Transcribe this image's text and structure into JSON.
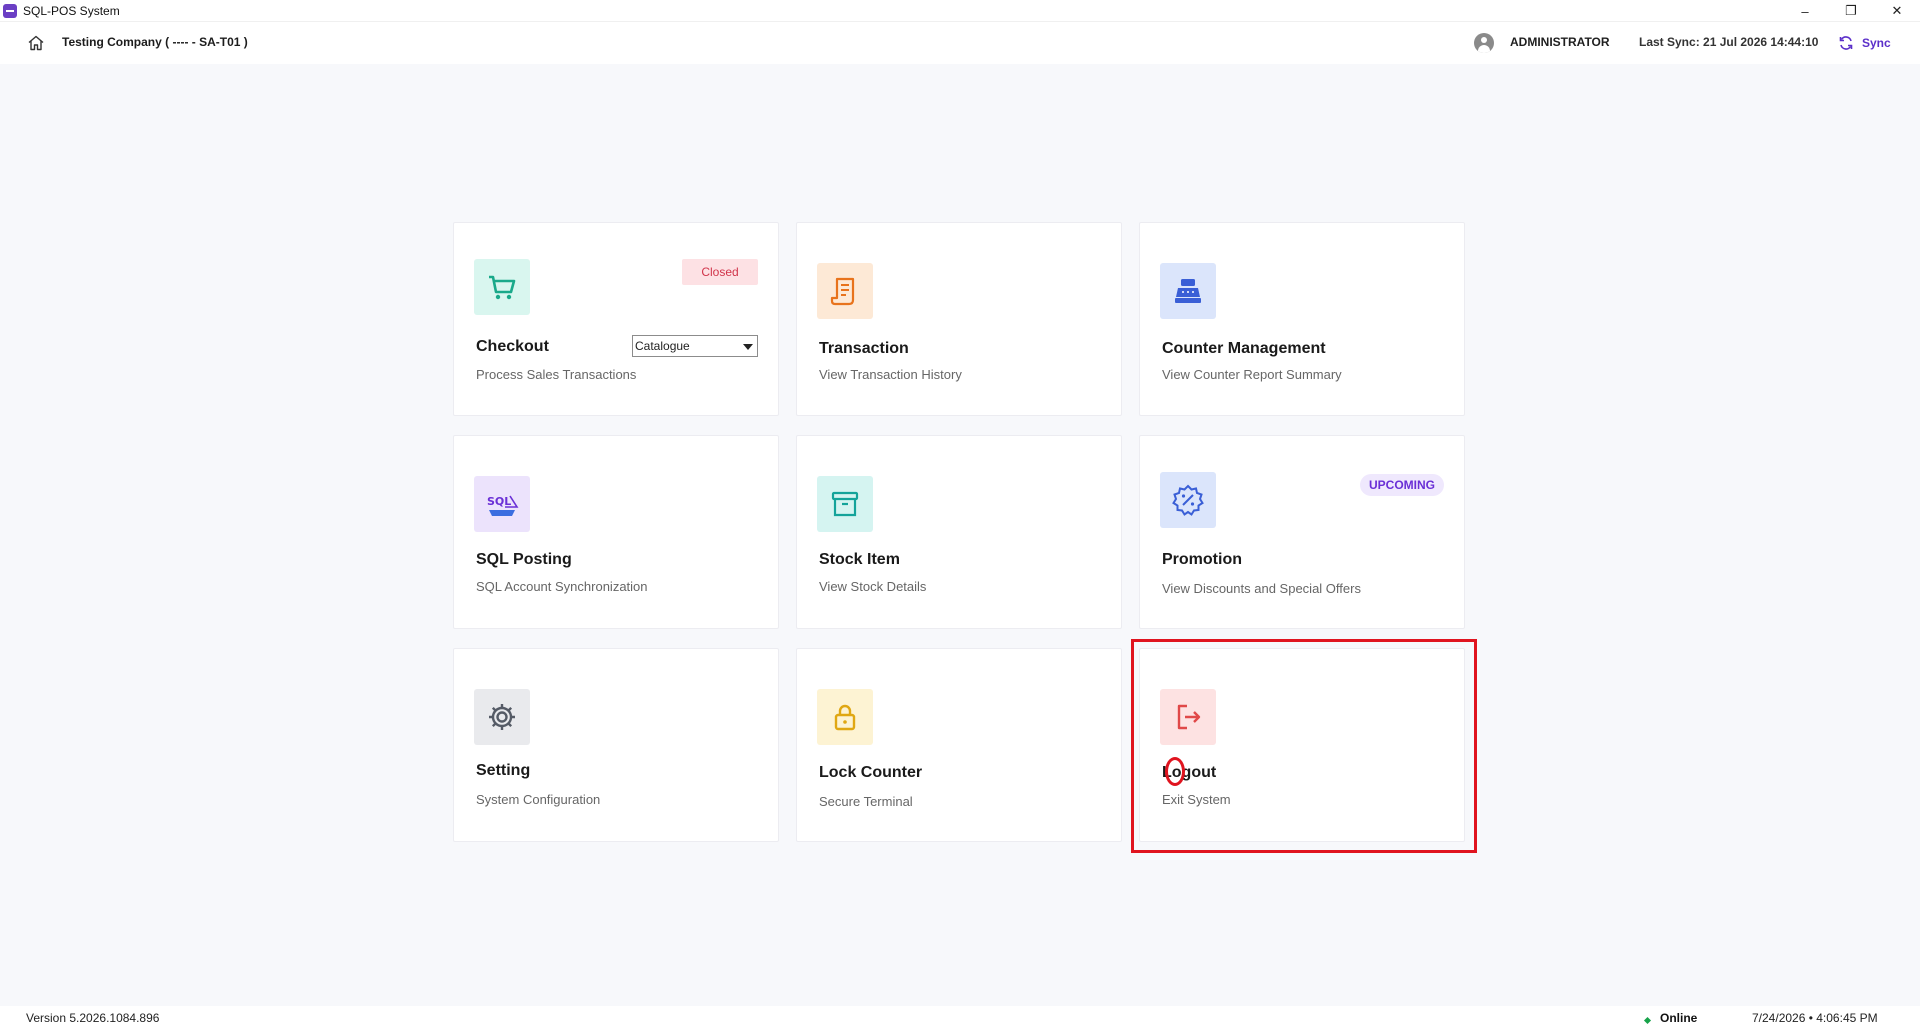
{
  "window": {
    "title": "SQL-POS System",
    "controls": [
      "–",
      "❐",
      "✕"
    ]
  },
  "header": {
    "company": "Testing Company ( ---- - SA-T01 )",
    "user": "ADMINISTRATOR",
    "last_sync": "Last Sync: 21 Jul 2026 14:44:10",
    "sync_label": "Sync"
  },
  "cards": {
    "checkout": {
      "title": "Checkout",
      "subtitle": "Process Sales Transactions",
      "badge": "Closed",
      "dropdown_value": "Catalogue",
      "icon": "cart-icon",
      "color": "#1aa98a"
    },
    "transaction": {
      "title": "Transaction",
      "subtitle": "View Transaction History",
      "icon": "receipt-icon",
      "color": "#e8731c"
    },
    "counter": {
      "title": "Counter Management",
      "subtitle": "View Counter Report Summary",
      "icon": "cash-register-icon",
      "color": "#3a5fd6"
    },
    "sql_posting": {
      "title": "SQL Posting",
      "subtitle": "SQL Account Synchronization",
      "icon": "sql-account-logo-icon",
      "color": "#6a2fd6"
    },
    "stock": {
      "title": "Stock Item",
      "subtitle": "View Stock Details",
      "icon": "archive-box-icon",
      "color": "#14a39a"
    },
    "promotion": {
      "title": "Promotion",
      "subtitle": "View Discounts and Special Offers",
      "badge": "UPCOMING",
      "icon": "discount-badge-icon",
      "color": "#3a5fd6"
    },
    "setting": {
      "title": "Setting",
      "subtitle": "System Configuration",
      "icon": "gear-icon",
      "color": "#555b66"
    },
    "lock": {
      "title": "Lock Counter",
      "subtitle": "Secure Terminal",
      "icon": "lock-icon",
      "color": "#e0a712"
    },
    "logout": {
      "title": "Logout",
      "subtitle": "Exit System",
      "icon": "logout-icon",
      "color": "#e04848"
    }
  },
  "footer": {
    "version": "Version 5.2026.1084.896",
    "status": "Online",
    "datetime": "7/24/2026  • 4:06:45 PM"
  }
}
